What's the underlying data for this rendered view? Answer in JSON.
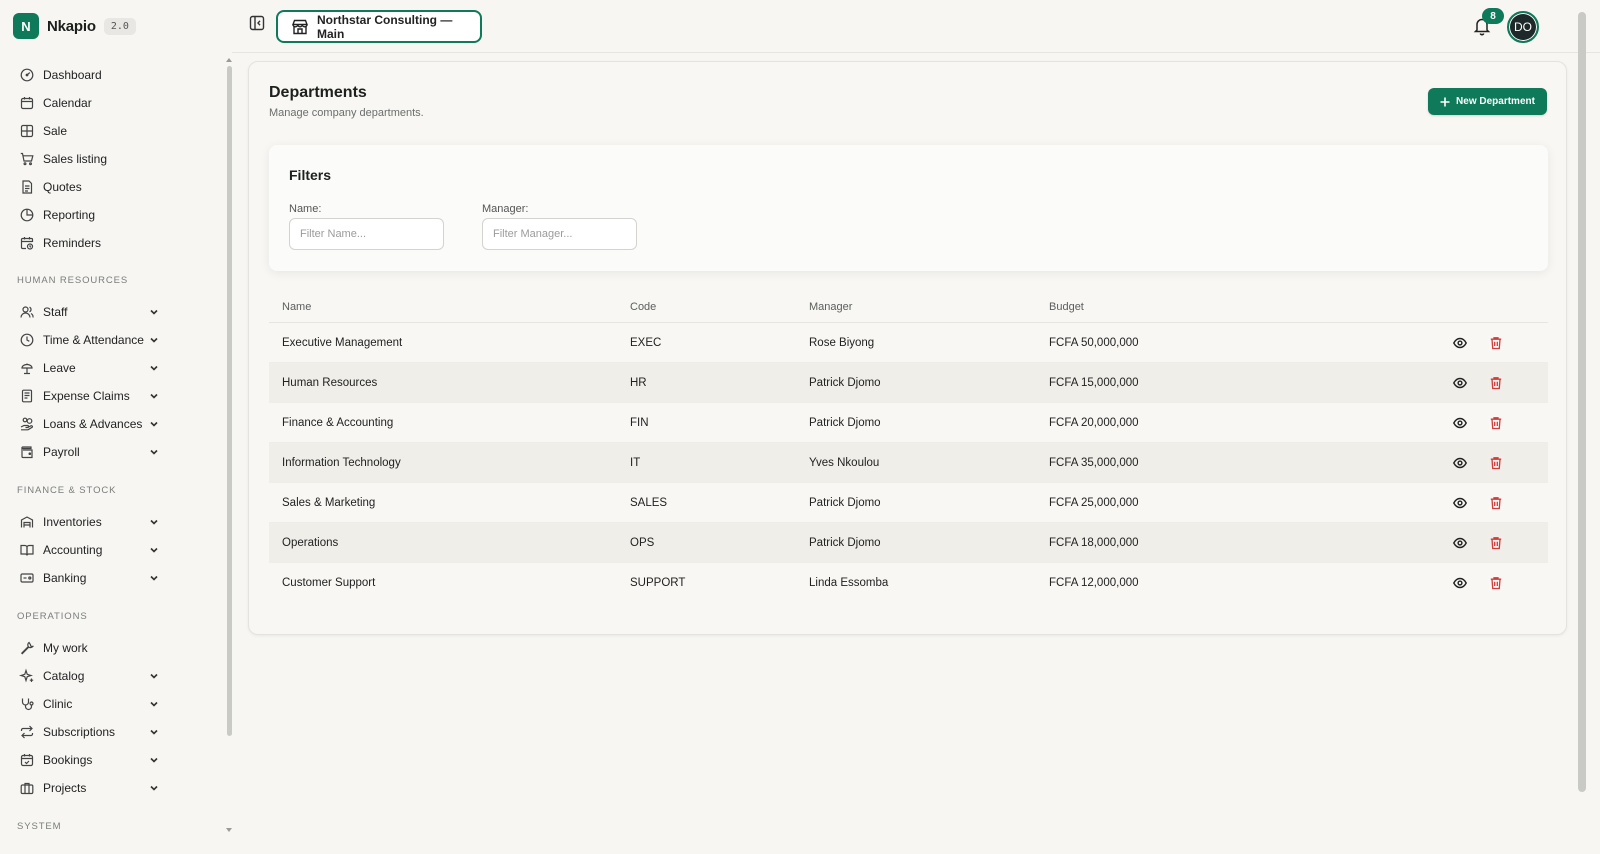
{
  "brand": {
    "logo_letter": "N",
    "name": "Nkapio",
    "version": "2.0"
  },
  "nav": {
    "top": [
      {
        "label": "Dashboard",
        "icon": "dashboard-icon"
      },
      {
        "label": "Calendar",
        "icon": "calendar-icon"
      },
      {
        "label": "Sale",
        "icon": "grid-icon"
      },
      {
        "label": "Sales listing",
        "icon": "cart-icon"
      },
      {
        "label": "Quotes",
        "icon": "document-icon"
      },
      {
        "label": "Reporting",
        "icon": "pie-chart-icon"
      },
      {
        "label": "Reminders",
        "icon": "calendar-clock-icon"
      }
    ],
    "hr_title": "HUMAN RESOURCES",
    "hr": [
      {
        "label": "Staff",
        "icon": "users-icon"
      },
      {
        "label": "Time & Attendance",
        "icon": "clock-icon"
      },
      {
        "label": "Leave",
        "icon": "leave-icon"
      },
      {
        "label": "Expense Claims",
        "icon": "receipt-icon"
      },
      {
        "label": "Loans & Advances",
        "icon": "hand-coins-icon"
      },
      {
        "label": "Payroll",
        "icon": "wallet-icon"
      }
    ],
    "fin_title": "FINANCE & STOCK",
    "fin": [
      {
        "label": "Inventories",
        "icon": "warehouse-icon"
      },
      {
        "label": "Accounting",
        "icon": "book-icon"
      },
      {
        "label": "Banking",
        "icon": "bank-card-icon"
      }
    ],
    "ops_title": "OPERATIONS",
    "ops": [
      {
        "label": "My work",
        "icon": "wrench-icon"
      },
      {
        "label": "Catalog",
        "icon": "sparkles-icon"
      },
      {
        "label": "Clinic",
        "icon": "stethoscope-icon"
      },
      {
        "label": "Subscriptions",
        "icon": "repeat-icon"
      },
      {
        "label": "Bookings",
        "icon": "calendar-check-icon"
      },
      {
        "label": "Projects",
        "icon": "briefcase-icon"
      }
    ],
    "sys_title": "SYSTEM"
  },
  "topbar": {
    "store_label": "Northstar Consulting — Main",
    "notification_count": "8",
    "avatar_initials": "DO"
  },
  "page": {
    "title": "Departments",
    "subtitle": "Manage company departments.",
    "new_button": "New Department"
  },
  "filters": {
    "title": "Filters",
    "name_label": "Name:",
    "name_placeholder": "Filter Name...",
    "name_value": "",
    "manager_label": "Manager:",
    "manager_placeholder": "Filter Manager...",
    "manager_value": ""
  },
  "table": {
    "headers": {
      "name": "Name",
      "code": "Code",
      "manager": "Manager",
      "budget": "Budget"
    },
    "rows": [
      {
        "name": "Executive Management",
        "code": "EXEC",
        "manager": "Rose Biyong",
        "budget": "FCFA 50,000,000"
      },
      {
        "name": "Human Resources",
        "code": "HR",
        "manager": "Patrick Djomo",
        "budget": "FCFA 15,000,000"
      },
      {
        "name": "Finance & Accounting",
        "code": "FIN",
        "manager": "Patrick Djomo",
        "budget": "FCFA 20,000,000"
      },
      {
        "name": "Information Technology",
        "code": "IT",
        "manager": "Yves Nkoulou",
        "budget": "FCFA 35,000,000"
      },
      {
        "name": "Sales & Marketing",
        "code": "SALES",
        "manager": "Patrick Djomo",
        "budget": "FCFA 25,000,000"
      },
      {
        "name": "Operations",
        "code": "OPS",
        "manager": "Patrick Djomo",
        "budget": "FCFA 18,000,000"
      },
      {
        "name": "Customer Support",
        "code": "SUPPORT",
        "manager": "Linda Essomba",
        "budget": "FCFA 12,000,000"
      }
    ]
  },
  "colors": {
    "accent": "#0f7a5a",
    "danger": "#d23a3a",
    "background": "#f7f6f3"
  }
}
